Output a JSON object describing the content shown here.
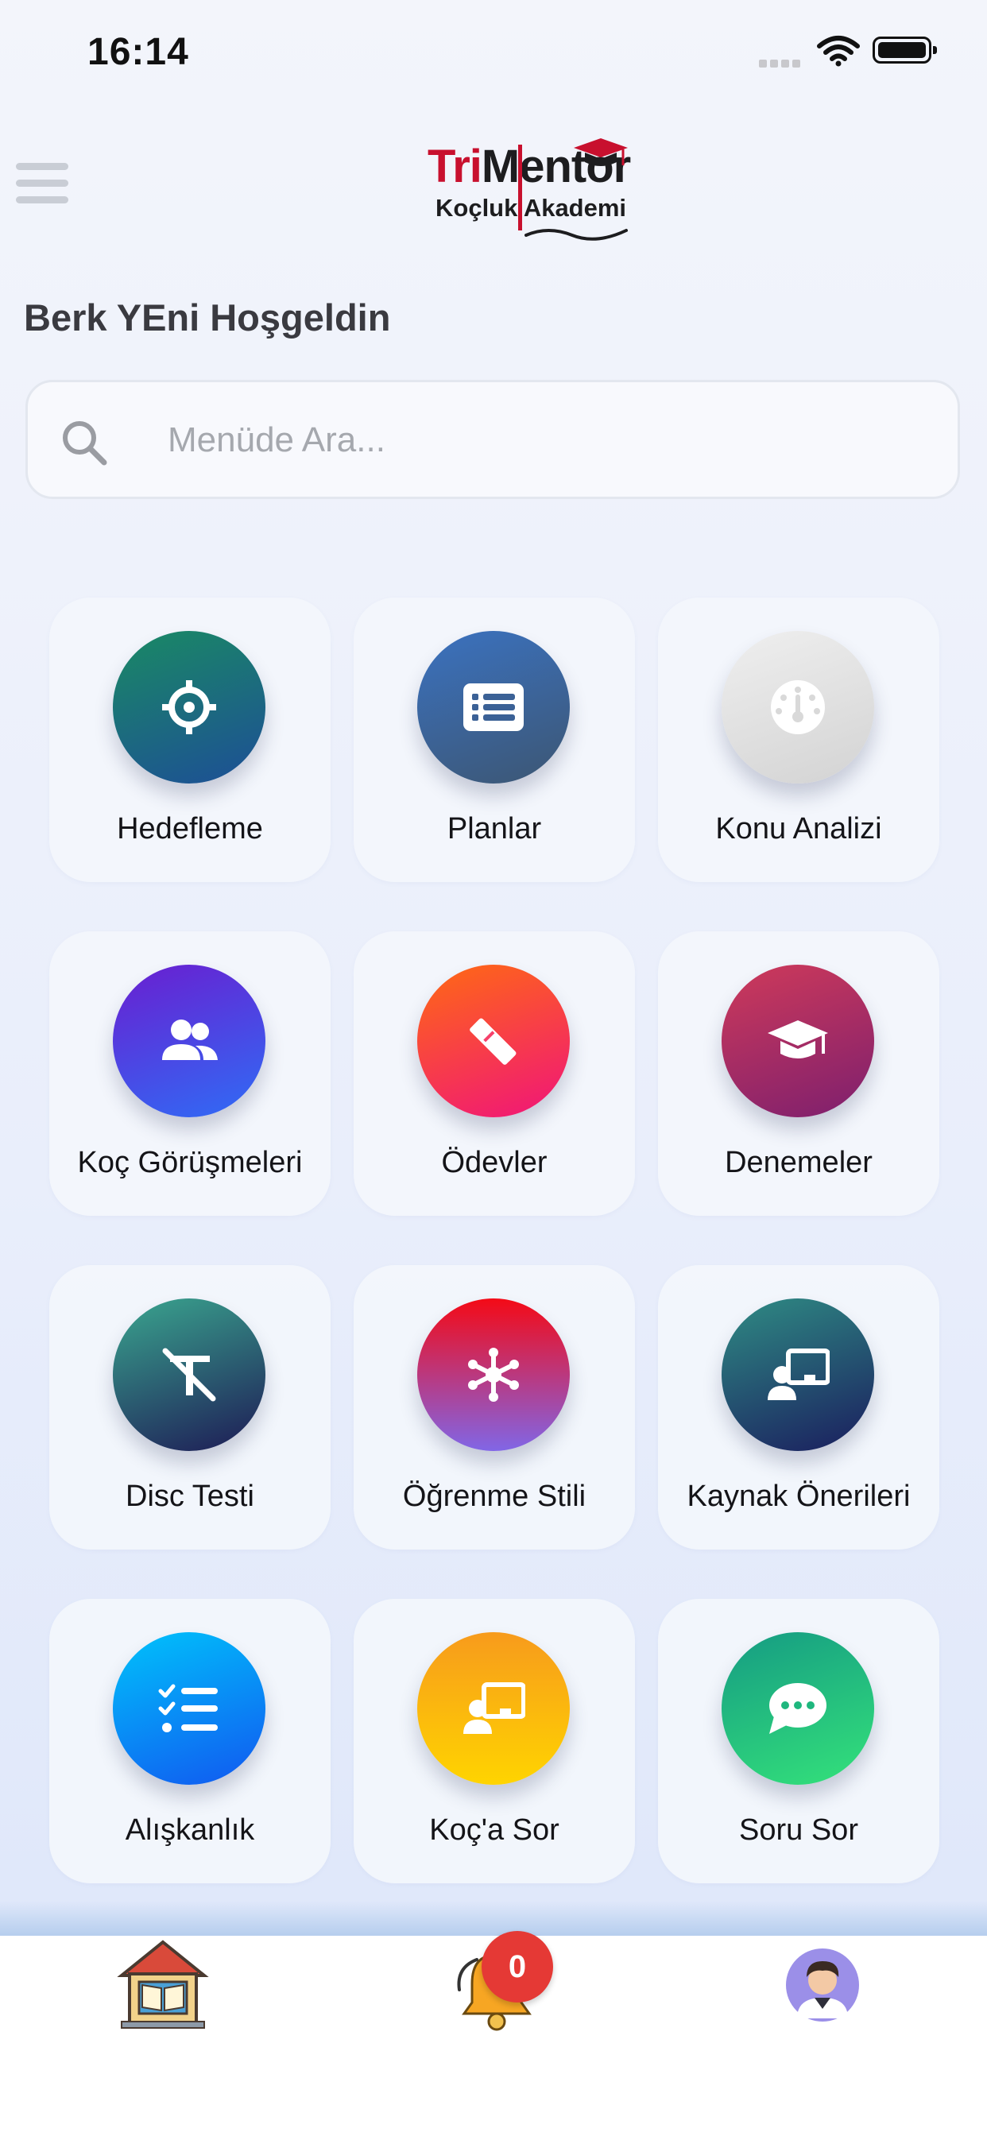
{
  "status_bar": {
    "time": "16:14"
  },
  "header": {
    "logo_top_tri": "Tri",
    "logo_top_mentor": "Mentor",
    "logo_bottom": "Koçluk Akademi"
  },
  "welcome_text": "Berk YEni Hoşgeldin",
  "search": {
    "placeholder": "Menüde Ara..."
  },
  "menu_items": [
    {
      "label": "Hedefleme",
      "icon": "crosshair-icon",
      "colors": [
        "#1a8a64",
        "#1d4e96"
      ]
    },
    {
      "label": "Planlar",
      "icon": "list-card-icon",
      "colors": [
        "#3b72c0",
        "#3c5673"
      ]
    },
    {
      "label": "Konu Analizi",
      "icon": "gauge-icon",
      "colors": [
        "#efefef",
        "#d3d3d3"
      ]
    },
    {
      "label": "Koç Görüşmeleri",
      "icon": "users-icon",
      "colors": [
        "#6a1ed0",
        "#2f6cf6"
      ]
    },
    {
      "label": "Ödevler",
      "icon": "pencil-ruler-icon",
      "colors": [
        "#ff6a13",
        "#f0147a"
      ]
    },
    {
      "label": "Denemeler",
      "icon": "graduation-cap-icon",
      "colors": [
        "#cf3a5a",
        "#7d1f6e"
      ]
    },
    {
      "label": "Disc Testi",
      "icon": "text-slash-icon",
      "colors": [
        "#3aa68f",
        "#1d1a55"
      ]
    },
    {
      "label": "Öğrenme Stili",
      "icon": "network-icon",
      "colors": [
        "#f40a16",
        "#8166e6"
      ]
    },
    {
      "label": "Kaynak Önerileri",
      "icon": "teacher-board-icon",
      "colors": [
        "#2f8c84",
        "#1a1d5e"
      ]
    },
    {
      "label": "Alışkanlık",
      "icon": "checklist-icon",
      "colors": [
        "#00c3fb",
        "#1158f0"
      ]
    },
    {
      "label": "Koç'a Sor",
      "icon": "teacher-board-icon",
      "colors": [
        "#f79b1c",
        "#ffd400"
      ]
    },
    {
      "label": "Soru Sor",
      "icon": "chat-bubble-icon",
      "colors": [
        "#159b83",
        "#34e27a"
      ]
    }
  ],
  "tab_bar": {
    "home_icon": "house-book-icon",
    "notifications_icon": "bell-icon",
    "notification_count": "0",
    "profile_icon": "avatar-icon"
  }
}
